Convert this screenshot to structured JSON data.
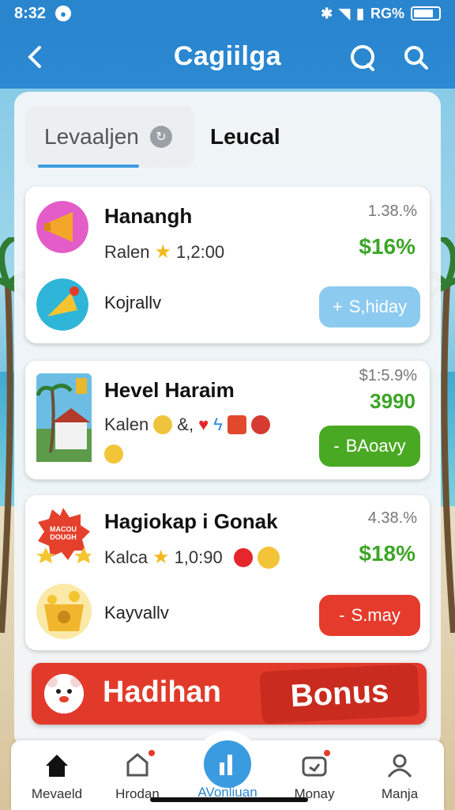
{
  "status_bar": {
    "time": "8:32",
    "battery_text": "RG%"
  },
  "header": {
    "title": "Cagiilga"
  },
  "tabs": [
    {
      "label": "Levaaljen"
    },
    {
      "label": "Leucal"
    }
  ],
  "cards": [
    {
      "title": "Hanangh",
      "meta_label": "Ralen",
      "meta_value": "1,2:00",
      "percent": "1.38.%",
      "price": "$16%",
      "sub_label": "Kojrallv",
      "button_label": "S,hiday",
      "button_prefix": "+"
    },
    {
      "title": "Hevel Haraim",
      "meta_label": "Kalen",
      "meta_value": "&,",
      "percent": "$1:5.9%",
      "price": "3990",
      "button_label": "BAoavy",
      "button_prefix": "-"
    },
    {
      "title": "Hagiokap i Gonak",
      "meta_label": "Kalca",
      "meta_value": "1,0:90",
      "percent": "4.38.%",
      "price": "$18%",
      "sub_label": "Kayvallv",
      "button_label": "S.may",
      "button_prefix": "-",
      "badge_text": "MACOU DOUGH"
    }
  ],
  "bonus": {
    "text": "Hadihan",
    "tag": "Bonus"
  },
  "bottom_nav": [
    {
      "label": "Mevaeld"
    },
    {
      "label": "Hrodan"
    },
    {
      "label": "AVonliuan"
    },
    {
      "label": "Monay"
    },
    {
      "label": "Manja"
    }
  ],
  "colors": {
    "primary": "#2a85cf",
    "price_green": "#3da528",
    "btn_blue": "#8ccaf0",
    "btn_green": "#4aa923",
    "btn_red": "#e53b2c",
    "bonus_red": "#e23a2a"
  }
}
